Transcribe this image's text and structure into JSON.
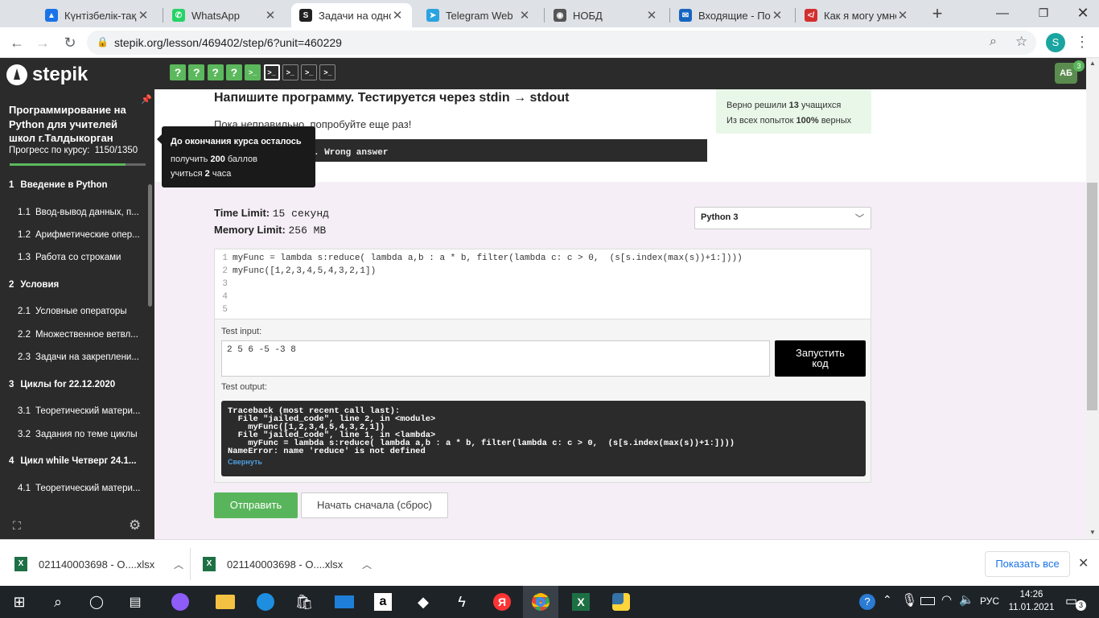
{
  "browser": {
    "tabs": [
      {
        "title": "Күнтізбелік-тақы",
        "icon": "google-drive-icon",
        "color": "#1a73e8"
      },
      {
        "title": "WhatsApp",
        "icon": "whatsapp-icon",
        "color": "#25d366"
      },
      {
        "title": "Задачи на одном",
        "icon": "stepik-icon",
        "color": "#222222"
      },
      {
        "title": "Telegram Web",
        "icon": "telegram-icon",
        "color": "#2aa3e0"
      },
      {
        "title": "НОБД",
        "icon": "globe-icon",
        "color": "#555555"
      },
      {
        "title": "Входящие - Почт",
        "icon": "mail-icon",
        "color": "#1565c0"
      },
      {
        "title": "Как я могу умно",
        "icon": "code-icon",
        "color": "#d32f2f"
      }
    ],
    "new_tab": "+",
    "url": "stepik.org/lesson/469402/step/6?unit=460229",
    "profile": "S"
  },
  "stepik": {
    "logo": "stepik",
    "step_buttons": [
      "?",
      "?",
      "?",
      "?",
      ">_",
      ">_",
      ">_",
      ">_",
      ">_"
    ],
    "avatar": "АБ",
    "avatar_badge": "3"
  },
  "sidebar": {
    "course_title": "Программирование на Python для учителей школ г.Талдыкорган",
    "progress_label": "Прогресс по курсу:",
    "progress_value": "1150/1350",
    "progress_fraction": 0.852,
    "modules": [
      {
        "kind": "section",
        "num": "1",
        "label": "Введение в Python"
      },
      {
        "kind": "lesson",
        "num": "1.1",
        "label": "Ввод-вывод данных, п..."
      },
      {
        "kind": "lesson",
        "num": "1.2",
        "label": "Арифметические опер..."
      },
      {
        "kind": "lesson",
        "num": "1.3",
        "label": "Работа со строками"
      },
      {
        "kind": "section",
        "num": "2",
        "label": "Условия"
      },
      {
        "kind": "lesson",
        "num": "2.1",
        "label": "Условные операторы"
      },
      {
        "kind": "lesson",
        "num": "2.2",
        "label": "Множественное ветвл..."
      },
      {
        "kind": "lesson",
        "num": "2.3",
        "label": "Задачи на закреплени..."
      },
      {
        "kind": "section",
        "num": "3",
        "label": "Циклы for 22.12.2020"
      },
      {
        "kind": "lesson",
        "num": "3.1",
        "label": "Теоретический матери..."
      },
      {
        "kind": "lesson",
        "num": "3.2",
        "label": "Задания по теме циклы"
      },
      {
        "kind": "section",
        "num": "4",
        "label": "Цикл while Четверг 24.1..."
      },
      {
        "kind": "lesson",
        "num": "4.1",
        "label": "Теоретический матери..."
      }
    ]
  },
  "tooltip": {
    "title": "До окончания курса осталось",
    "line1_pre": "получить ",
    "line1_num": "200",
    "line1_post": " баллов",
    "line2_pre": "учиться ",
    "line2_num": "2",
    "line2_post": " часа"
  },
  "task": {
    "heading": "Напишите программу. Тестируется через stdin → stdout",
    "stats_line1_pre": "Верно решили ",
    "stats_line1_num": "13",
    "stats_line1_post": " учащихся",
    "stats_line2_pre": "Из всех попыток ",
    "stats_line2_num": "100%",
    "stats_line2_post": " верных",
    "feedback": "Пока неправильно, попробуйте еще раз!",
    "wrong_answer": ". Wrong answer",
    "time_limit_label": "Time Limit:",
    "time_limit_value": "15 секунд",
    "memory_limit_label": "Memory Limit:",
    "memory_limit_value": "256 MB",
    "language": "Python 3",
    "code_lines": [
      "myFunc = lambda s:reduce( lambda a,b : a * b, filter(lambda c: c > 0,  (s[s.index(max(s))+1:])))",
      "myFunc([1,2,3,4,5,4,3,2,1])",
      "",
      "",
      ""
    ],
    "test_input_label": "Test input:",
    "test_input_value": "2 5 6 -5 -3 8",
    "run_button": "Запустить код",
    "test_output_label": "Test output:",
    "output_lines": [
      "Traceback (most recent call last):",
      "  File \"jailed_code\", line 2, in <module>",
      "    myFunc([1,2,3,4,5,4,3,2,1])",
      "  File \"jailed_code\", line 1, in <lambda>",
      "    myFunc = lambda s:reduce( lambda a,b : a * b, filter(lambda c: c > 0,  (s[s.index(max(s))+1:])))",
      "NameError: name 'reduce' is not defined"
    ],
    "collapse_link": "Свернуть",
    "submit_button": "Отправить",
    "reset_button": "Начать сначала (сброс)"
  },
  "downloads": {
    "items": [
      "021140003698 - О....xlsx",
      "021140003698 - О....xlsx"
    ],
    "show_all": "Показать все"
  },
  "taskbar": {
    "language": "РУС",
    "time": "14:26",
    "date": "11.01.2021"
  }
}
